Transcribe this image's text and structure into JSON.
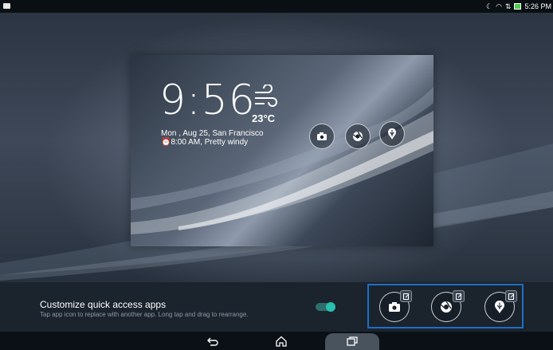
{
  "statusbar": {
    "time": "5:26 PM"
  },
  "preview": {
    "clock": "9:56",
    "temperature": "23°C",
    "date_line": "Mon , Aug 25, San Francisco",
    "alarm_line": "8:00 AM, Pretty windy"
  },
  "quick_access": {
    "title": "Customize quick access apps",
    "subtitle": "Tap app icon to replace with another app. Long tap and drag to rearrange.",
    "toggle_on": true,
    "apps": [
      "camera",
      "chrome",
      "weather"
    ]
  },
  "colors": {
    "accent": "#29c0b0",
    "selection": "#1e6fc4"
  }
}
